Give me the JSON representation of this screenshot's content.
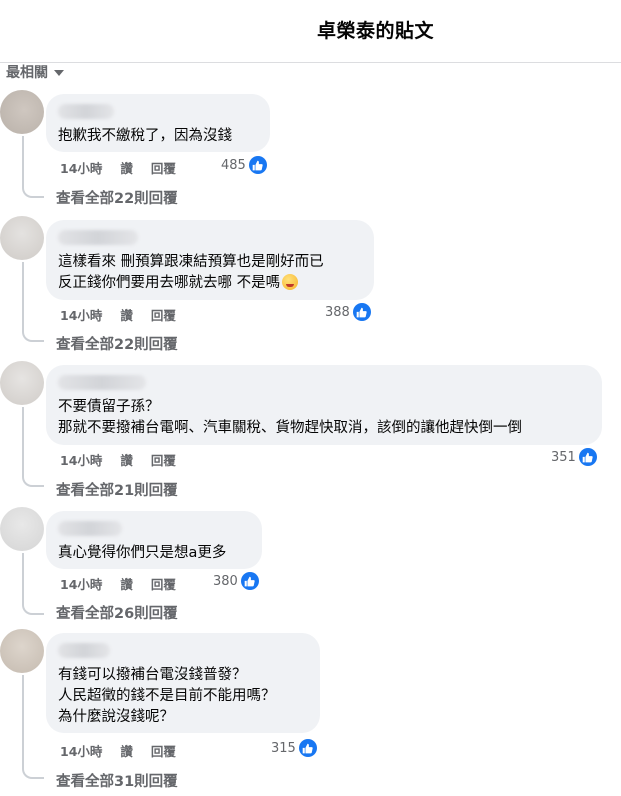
{
  "header": {
    "title": "卓榮泰的貼文"
  },
  "sort": {
    "label": "最相關"
  },
  "labels": {
    "like": "讚",
    "reply": "回覆"
  },
  "comments": [
    {
      "text": "抱歉我不繳稅了，因為沒錢",
      "time": "14小時",
      "likes": "485",
      "view_replies": "查看全部22則回覆"
    },
    {
      "text_line1": "這樣看來 刪預算跟凍結預算也是剛好而已",
      "text_line2": "反正錢你們要用去哪就去哪 不是嗎",
      "time": "14小時",
      "likes": "388",
      "view_replies": "查看全部22則回覆"
    },
    {
      "text": "不要債留子孫？\n那就不要撥補台電啊、汽車關稅、貨物趕快取消，該倒的讓他趕快倒一倒",
      "time": "14小時",
      "likes": "351",
      "view_replies": "查看全部21則回覆"
    },
    {
      "text": "真心覺得你們只是想a更多",
      "time": "14小時",
      "likes": "380",
      "view_replies": "查看全部26則回覆"
    },
    {
      "text": "有錢可以撥補台電沒錢普發？\n人民超徵的錢不是目前不能用嗎？\n為什麼說沒錢呢？",
      "time": "14小時",
      "likes": "315",
      "view_replies": "查看全部31則回覆"
    }
  ],
  "icons": {
    "like": "thumbs-up-icon",
    "sort_caret": "caret-down-icon",
    "emoji": "face-emoji-icon"
  },
  "colors": {
    "accent": "#1877f2",
    "bubble": "#f0f2f5",
    "muted": "#65676b"
  }
}
